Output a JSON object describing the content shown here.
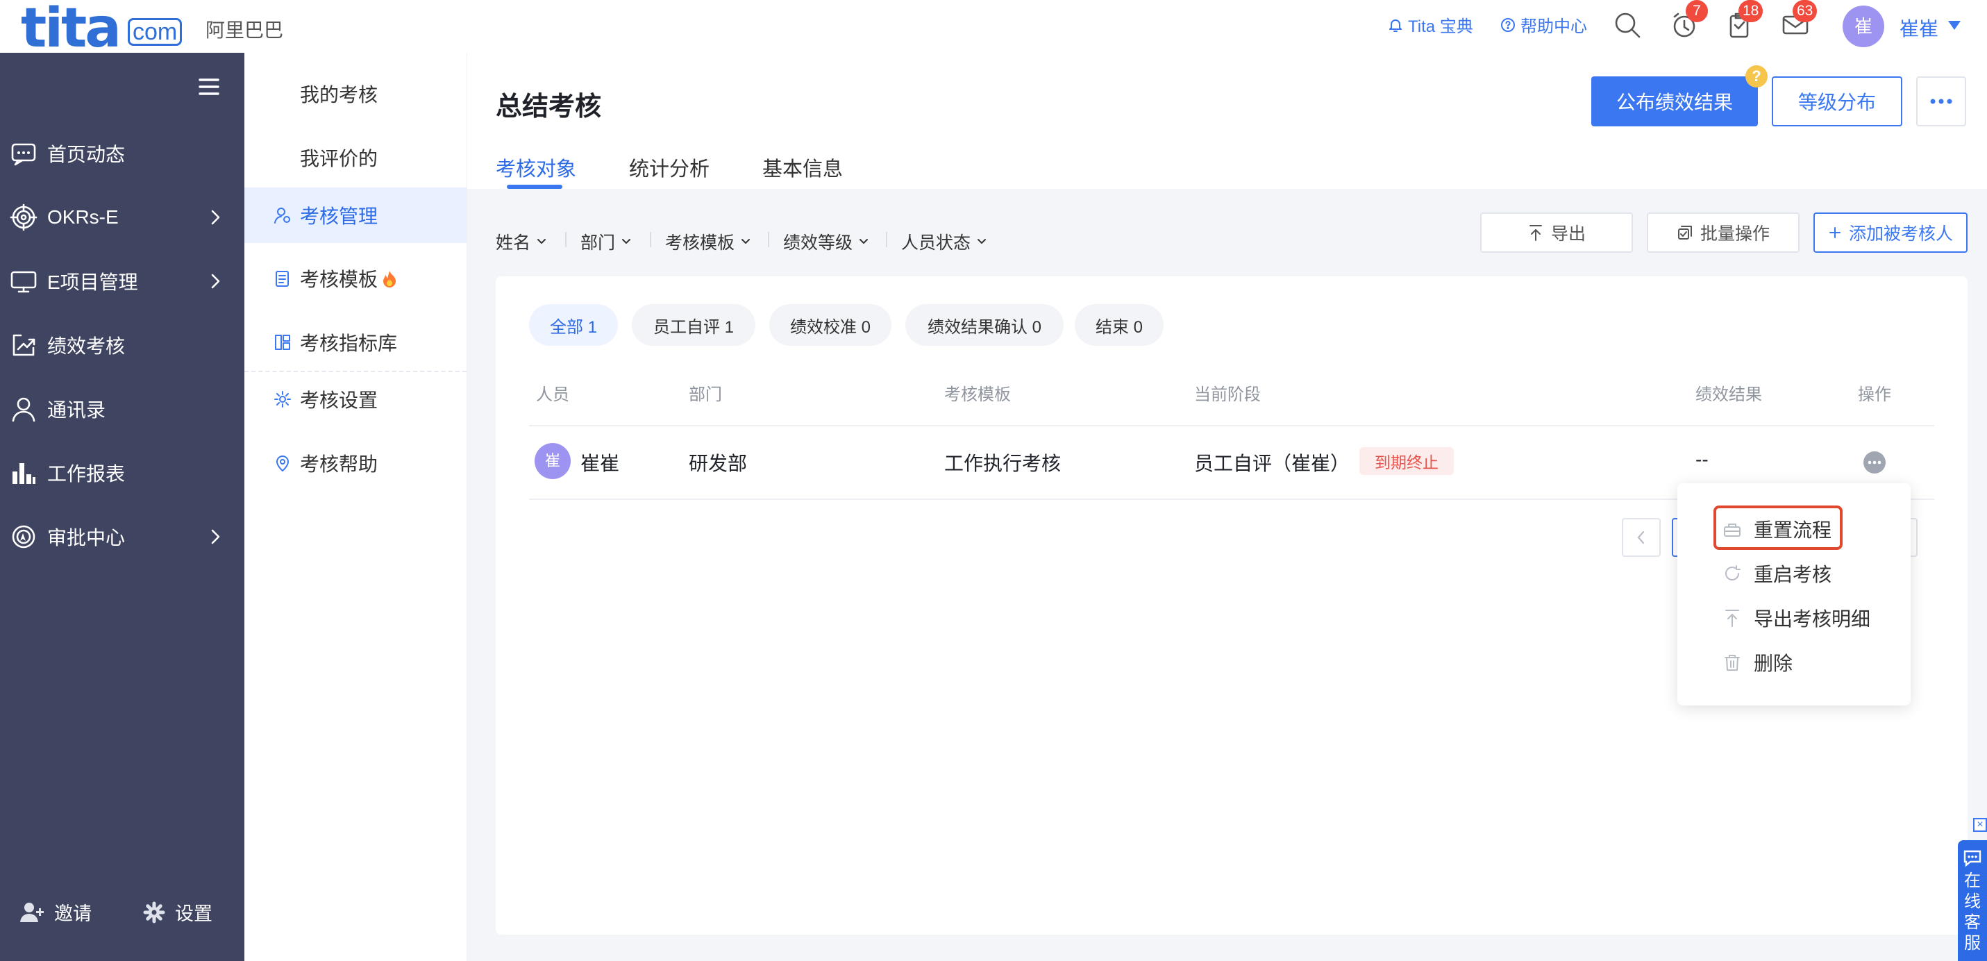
{
  "header": {
    "logo_text": "tita",
    "logo_suffix": "com",
    "org_name": "阿里巴巴",
    "links": {
      "guide": "Tita 宝典",
      "help": "帮助中心"
    },
    "badges": {
      "reminders": "7",
      "tasks": "18",
      "messages": "63"
    },
    "user": {
      "avatar": "崔",
      "name": "崔崔"
    }
  },
  "leftnav": {
    "items": [
      {
        "label": "首页动态",
        "icon": "chat-icon",
        "has_arrow": false
      },
      {
        "label": "OKRs-E",
        "icon": "target-icon",
        "has_arrow": true
      },
      {
        "label": "E项目管理",
        "icon": "monitor-icon",
        "has_arrow": true
      },
      {
        "label": "绩效考核",
        "icon": "trend-icon",
        "has_arrow": false
      },
      {
        "label": "通讯录",
        "icon": "person-icon",
        "has_arrow": false
      },
      {
        "label": "工作报表",
        "icon": "bar-chart-icon",
        "has_arrow": false
      },
      {
        "label": "审批中心",
        "icon": "approval-icon",
        "has_arrow": true
      }
    ],
    "footer": {
      "invite": "邀请",
      "settings": "设置"
    }
  },
  "subnav": {
    "items": [
      {
        "label": "我的考核"
      },
      {
        "label": "我评价的"
      },
      {
        "label": "考核管理",
        "active": true
      },
      {
        "label": "考核模板",
        "hot": true
      },
      {
        "label": "考核指标库"
      },
      {
        "label": "考核设置"
      },
      {
        "label": "考核帮助"
      }
    ]
  },
  "main": {
    "title": "总结考核",
    "buttons": {
      "publish": "公布绩效结果",
      "publish_badge": "?",
      "grade": "等级分布"
    },
    "tabs": [
      "考核对象",
      "统计分析",
      "基本信息"
    ],
    "active_tab": 0,
    "filters": [
      "姓名",
      "部门",
      "考核模板",
      "绩效等级",
      "人员状态"
    ],
    "actions": {
      "export": "导出",
      "batch": "批量操作",
      "add": "添加被考核人"
    },
    "status_pills": [
      "全部 1",
      "员工自评 1",
      "绩效校准 0",
      "绩效结果确认 0",
      "结束 0"
    ],
    "table": {
      "columns": [
        "人员",
        "部门",
        "考核模板",
        "当前阶段",
        "绩效结果",
        "操作"
      ],
      "rows": [
        {
          "avatar": "崔",
          "name": "崔崔",
          "dept": "研发部",
          "template": "工作执行考核",
          "stage": "员工自评（崔崔）",
          "tag": "到期终止",
          "result": "--"
        }
      ]
    },
    "row_menu": [
      "重置流程",
      "重启考核",
      "导出考核明细",
      "删除"
    ],
    "highlighted_menu_item": 0
  },
  "chat_widget": {
    "close": "×",
    "label": "在线客服"
  },
  "colors": {
    "primary": "#3a77f0",
    "sidebar": "#3f4461",
    "danger": "#e5534b",
    "highlight": "#e0492f"
  }
}
